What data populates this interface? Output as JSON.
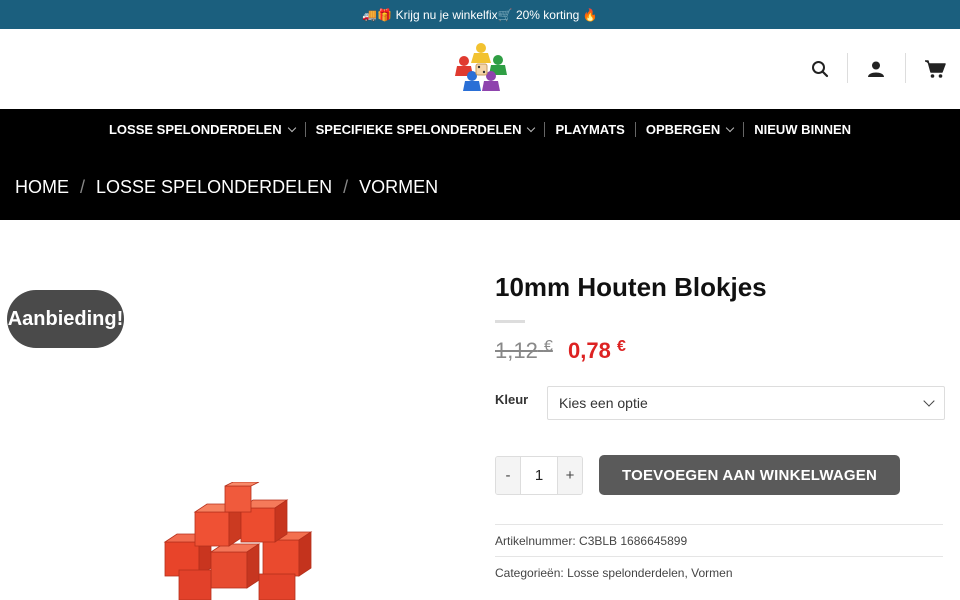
{
  "topbar": {
    "promo_text": "🚚🎁 Krijg nu je winkelfix🛒 20% korting 🔥"
  },
  "header": {
    "logo_alt": "logo",
    "icons": [
      "search-icon",
      "user-icon",
      "cart-icon"
    ]
  },
  "nav": {
    "menu": [
      {
        "label": "LOSSE SPELONDERDELEN",
        "dropdown": true
      },
      {
        "label": "SPECIFIEKE SPELONDERDELEN",
        "dropdown": true
      },
      {
        "label": "PLAYMATS",
        "dropdown": false
      },
      {
        "label": "OPBERGEN",
        "dropdown": true
      },
      {
        "label": "NIEUW BINNEN",
        "dropdown": false
      }
    ],
    "breadcrumb": [
      "HOME",
      "LOSSE SPELONDERDELEN",
      "VORMEN"
    ]
  },
  "gallery": {
    "badge": "Aanbieding!"
  },
  "product": {
    "title": "10mm Houten Blokjes",
    "price_old": "1,12",
    "price_new": "0,78",
    "currency": "€",
    "option_label": "Kleur",
    "option_placeholder": "Kies een optie",
    "qty_minus": "-",
    "qty_value": "1",
    "qty_plus": "+",
    "add_to_cart": "TOEVOEGEN AAN WINKELWAGEN",
    "sku_label": "Artikelnummer:",
    "sku_value": "C3BLB 1686645899",
    "cat_label": "Categorieën:",
    "categories": [
      "Losse spelonderdelen",
      "Vormen"
    ]
  },
  "colors": {
    "topbar": "#1b5f7e",
    "nav": "#000000",
    "price_sale": "#dd2222",
    "button": "#5a5a5a"
  }
}
